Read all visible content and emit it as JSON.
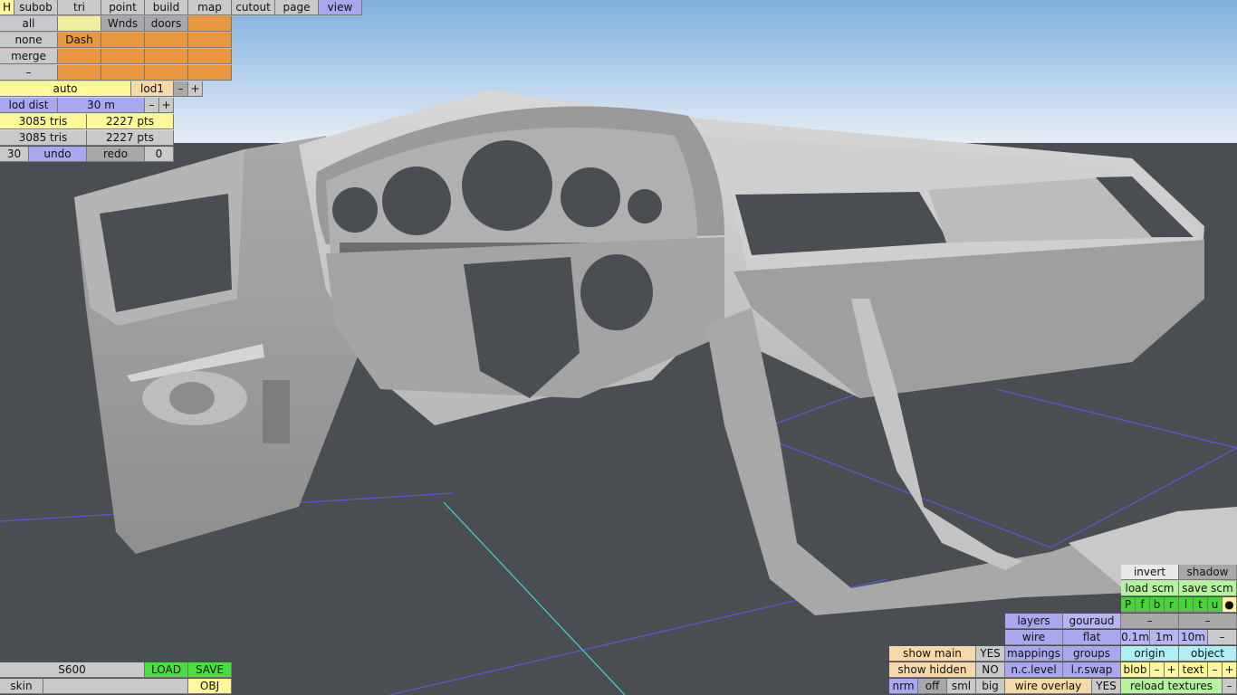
{
  "menu": {
    "h": "H",
    "tabs": [
      "subob",
      "tri",
      "point",
      "build",
      "map",
      "cutout",
      "page",
      "view"
    ]
  },
  "groups": {
    "all": "all",
    "none": "none",
    "merge": "merge",
    "minus": "–",
    "wnds": "Wnds",
    "doors": "doors",
    "dash": "Dash"
  },
  "lod": {
    "auto": "auto",
    "lod1": "lod1",
    "minus": "–",
    "plus": "+",
    "lod_dist_label": "lod dist",
    "lod_dist_value": "30 m"
  },
  "stats": {
    "row1_tris": "3085 tris",
    "row1_pts": "2227 pts",
    "row2_tris": "3085 tris",
    "row2_pts": "2227 pts"
  },
  "history": {
    "count": "30",
    "undo": "undo",
    "redo": "redo",
    "redo_count": "0"
  },
  "file": {
    "name": "S600",
    "load": "LOAD",
    "save": "SAVE",
    "skin": "skin",
    "obj": "OBJ"
  },
  "render": {
    "invert": "invert",
    "shadow": "shadow",
    "load_scm": "load scm",
    "save_scm": "save scm",
    "views": [
      "P",
      "f",
      "b",
      "r",
      "l",
      "t",
      "u",
      "●"
    ],
    "layers": "layers",
    "gouraud": "gouraud",
    "wire": "wire",
    "flat": "flat",
    "mappings": "mappings",
    "groups": "groups",
    "nclevel": "n.c.level",
    "lrswap": "l.r.swap",
    "dash1": "–",
    "dash2": "–",
    "d01": "0.1m",
    "d1": "1m",
    "d10": "10m",
    "dminus": "–",
    "origin": "origin",
    "object": "object",
    "blob": "blob",
    "blob_minus": "–",
    "blob_plus": "+",
    "text": "text",
    "text_minus": "–",
    "text_plus": "+",
    "show_main": "show main",
    "show_main_val": "YES",
    "show_hidden": "show hidden",
    "show_hidden_val": "NO",
    "nrm": "nrm",
    "off": "off",
    "sml": "sml",
    "big": "big",
    "wire_overlay": "wire overlay",
    "wire_overlay_val": "YES",
    "reload_textures": "reload textures",
    "reload_minus": "–"
  }
}
